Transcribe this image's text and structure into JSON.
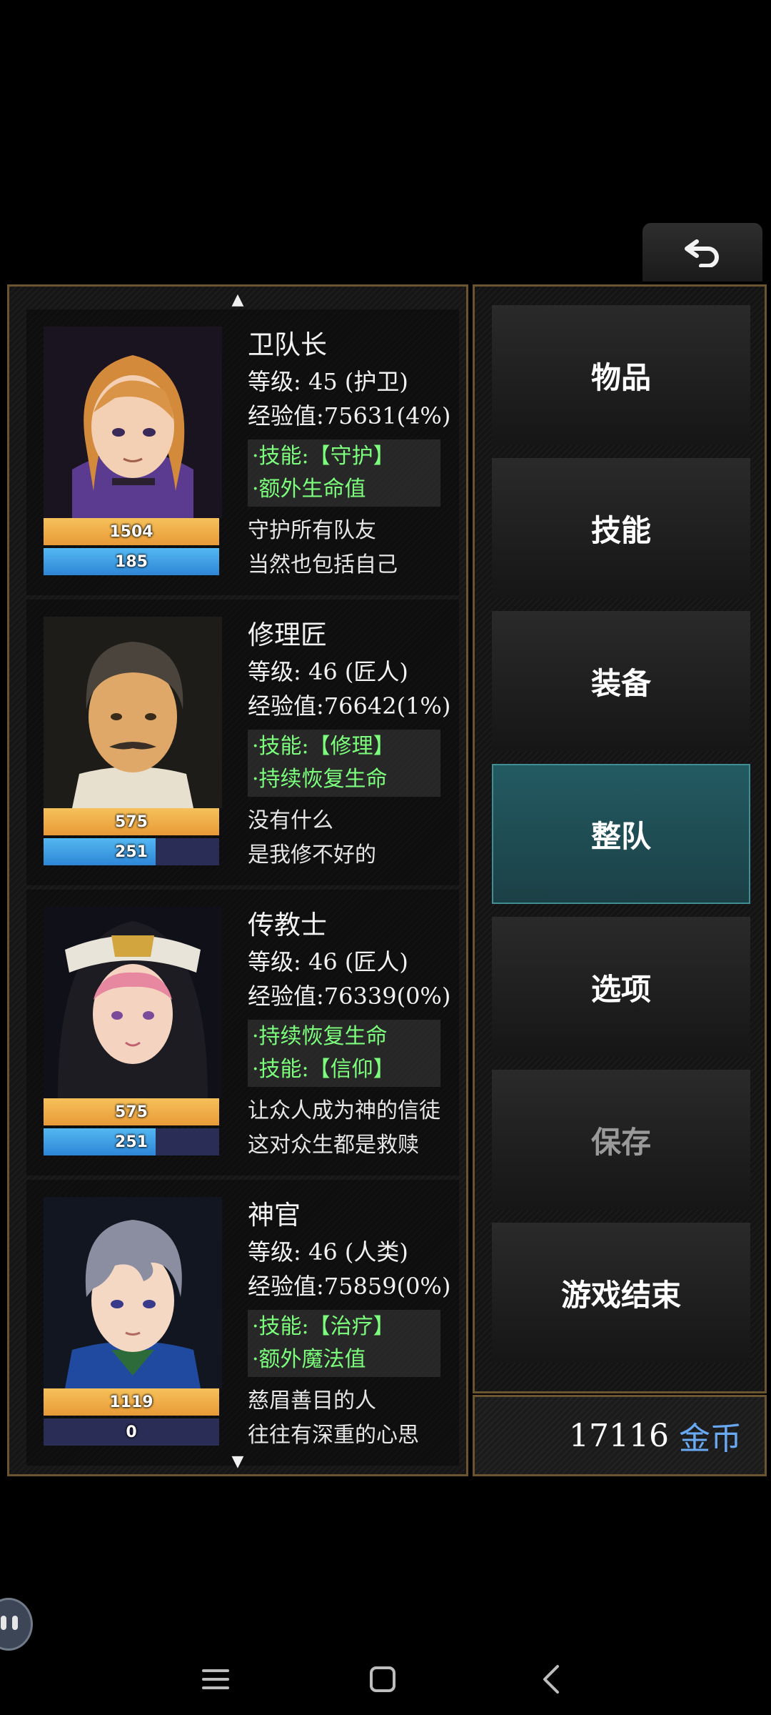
{
  "header": {
    "ghost_title": "",
    "back_icon": "back-arrow-icon"
  },
  "roster": {
    "characters": [
      {
        "name": "卫队长",
        "level": "等级: 45 (护卫)",
        "exp": "经验值:75631(4%)",
        "tags": [
          "·技能:【守护】",
          "·额外生命值"
        ],
        "desc": [
          "守护所有队友",
          "当然也包括自己"
        ],
        "hp": "1504",
        "mp": "185",
        "mp_fraction": 1.0
      },
      {
        "name": "修理匠",
        "level": "等级: 46 (匠人)",
        "exp": "经验值:76642(1%)",
        "tags": [
          "·技能:【修理】",
          "·持续恢复生命"
        ],
        "desc": [
          "没有什么",
          "是我修不好的"
        ],
        "hp": "575",
        "mp": "251",
        "mp_fraction": 0.64
      },
      {
        "name": "传教士",
        "level": "等级: 46 (匠人)",
        "exp": "经验值:76339(0%)",
        "tags": [
          "·持续恢复生命",
          "·技能:【信仰】"
        ],
        "desc": [
          "让众人成为神的信徒",
          "这对众生都是救赎"
        ],
        "hp": "575",
        "mp": "251",
        "mp_fraction": 0.64
      },
      {
        "name": "神官",
        "level": "等级: 46 (人类)",
        "exp": "经验值:75859(0%)",
        "tags": [
          "·技能:【治疗】",
          "·额外魔法值"
        ],
        "desc": [
          "慈眉善目的人",
          "往往有深重的心思"
        ],
        "hp": "1119",
        "mp": "0",
        "mp_fraction": 0.0
      }
    ]
  },
  "menu": {
    "items": [
      "物品",
      "技能",
      "装备",
      "整队",
      "选项",
      "保存",
      "游戏结束"
    ],
    "active_index": 3,
    "disabled_index": 5
  },
  "gold": {
    "amount": "17116",
    "unit": "金币"
  },
  "colors": {
    "accent_teal": "#235a62",
    "skill_green": "#7cff7c",
    "gold_unit_blue": "#69a8f2",
    "hp_orange": "#f6c15a",
    "mp_blue": "#2e86d6"
  }
}
